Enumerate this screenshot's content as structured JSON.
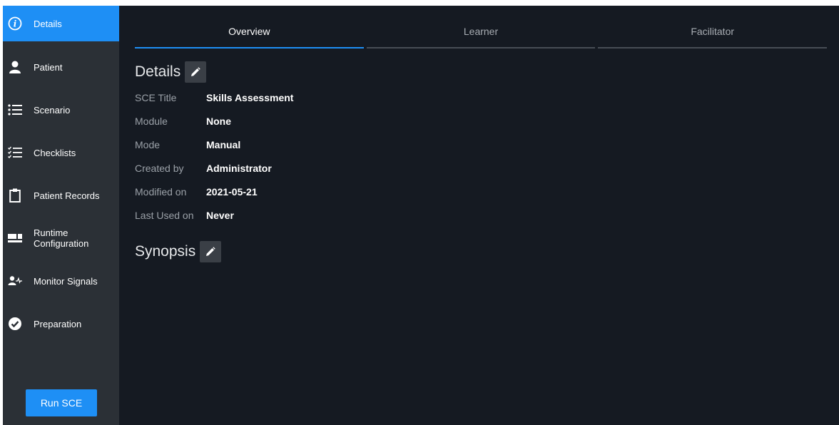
{
  "sidebar": {
    "items": [
      {
        "label": "Details",
        "icon": "info-icon",
        "active": true
      },
      {
        "label": "Patient",
        "icon": "person-icon"
      },
      {
        "label": "Scenario",
        "icon": "list-icon"
      },
      {
        "label": "Checklists",
        "icon": "checklist-icon"
      },
      {
        "label": "Patient Records",
        "icon": "clipboard-icon"
      },
      {
        "label": "Runtime\nConfiguration",
        "icon": "layout-icon"
      },
      {
        "label": "Monitor Signals",
        "icon": "person-pulse-icon"
      },
      {
        "label": "Preparation",
        "icon": "check-circle-icon"
      }
    ],
    "run_button": "Run SCE"
  },
  "tabs": [
    {
      "label": "Overview",
      "active": true
    },
    {
      "label": "Learner"
    },
    {
      "label": "Facilitator"
    }
  ],
  "details": {
    "title": "Details",
    "fields": [
      {
        "label": "SCE Title",
        "value": "Skills Assessment"
      },
      {
        "label": "Module",
        "value": "None"
      },
      {
        "label": "Mode",
        "value": "Manual"
      },
      {
        "label": "Created by",
        "value": "Administrator"
      },
      {
        "label": "Modified on",
        "value": "2021-05-21"
      },
      {
        "label": "Last Used on",
        "value": "Never"
      }
    ]
  },
  "synopsis": {
    "title": "Synopsis"
  },
  "colors": {
    "accent": "#1e8ff5",
    "sidebar_bg": "#2b3036",
    "main_bg": "#151a22"
  }
}
